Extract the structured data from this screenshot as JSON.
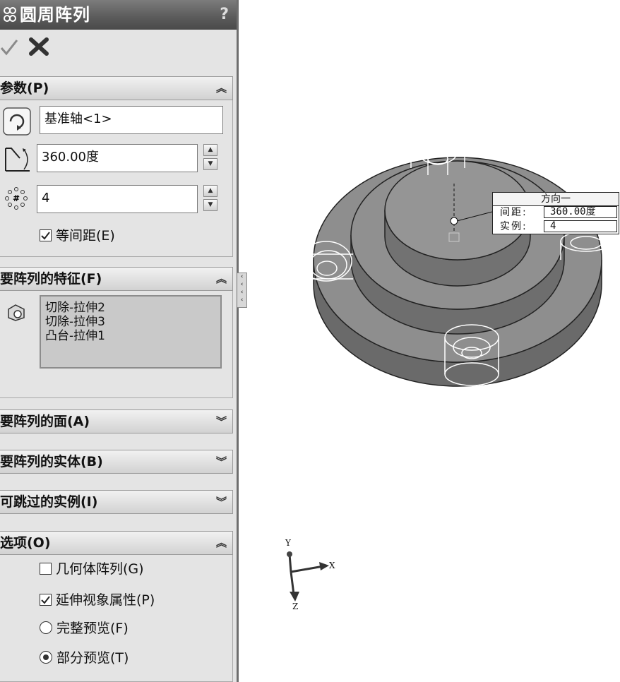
{
  "title": {
    "text": "圆周阵列",
    "help": "?"
  },
  "params": {
    "header": "参数(P)",
    "axis_value": "基准轴<1>",
    "angle_value": "360.00度",
    "count_value": "4",
    "equal_spacing": {
      "label": "等间距(E)",
      "checked": true
    }
  },
  "features": {
    "header": "要阵列的特征(F)",
    "items": [
      "切除-拉伸2",
      "切除-拉伸3",
      "凸台-拉伸1"
    ]
  },
  "faces": {
    "header": "要阵列的面(A)"
  },
  "bodies": {
    "header": "要阵列的实体(B)"
  },
  "skip": {
    "header": "可跳过的实例(I)"
  },
  "options": {
    "header": "选项(O)",
    "geometry_pattern": {
      "label": "几何体阵列(G)",
      "checked": false
    },
    "propagate_visual": {
      "label": "延伸视象属性(P)",
      "checked": true
    },
    "full_preview": {
      "label": "完整预览(F)",
      "selected": false
    },
    "partial_preview": {
      "label": "部分预览(T)",
      "selected": true
    }
  },
  "callout": {
    "title": "方向一",
    "spacing_label": "间距:",
    "spacing_value": "360.00度",
    "instances_label": "实例:",
    "instances_value": "4"
  },
  "triad": {
    "x": "X",
    "y": "Y",
    "z": "Z"
  },
  "icons": [
    "pattern-feature-icon",
    "ok-check-icon",
    "cancel-x-icon",
    "rotate-axis-icon",
    "angle-icon",
    "instance-count-icon",
    "feature-list-icon"
  ]
}
